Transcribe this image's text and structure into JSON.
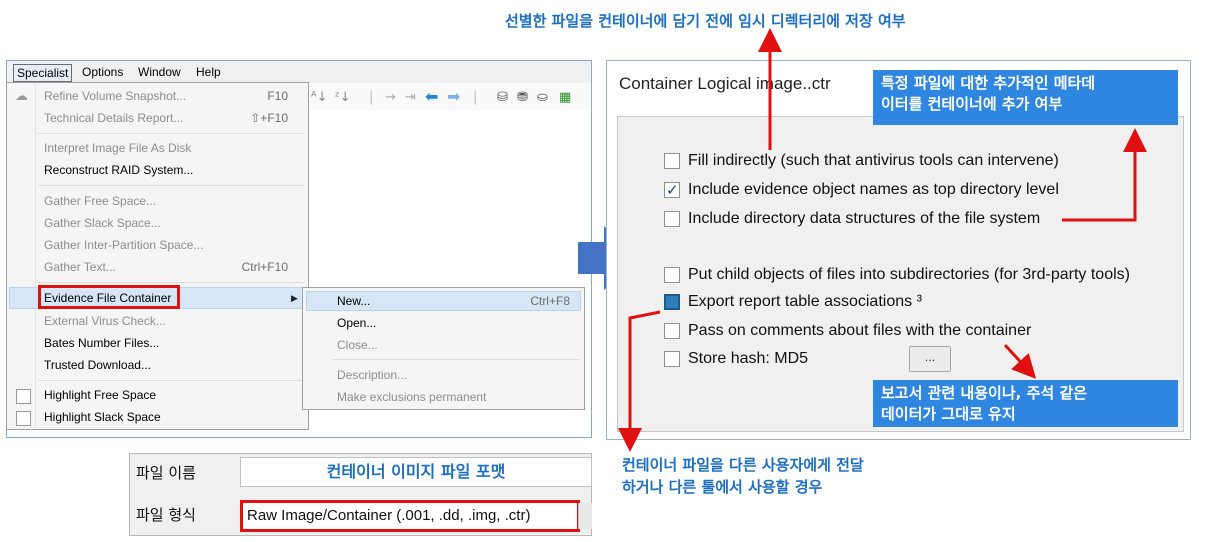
{
  "menubar": {
    "items": [
      "Specialist",
      "Options",
      "Window",
      "Help"
    ]
  },
  "menu": {
    "items": [
      {
        "label": "Refine Volume Snapshot...",
        "shortcut": "F10",
        "disabled": true
      },
      {
        "label": "Technical Details Report...",
        "shortcut": "⇧+F10",
        "disabled": true
      },
      {
        "label": "Interpret Image File As Disk",
        "shortcut": "",
        "disabled": true
      },
      {
        "label": "Reconstruct RAID System...",
        "shortcut": "",
        "disabled": false
      },
      {
        "label": "Gather Free Space...",
        "shortcut": "",
        "disabled": true
      },
      {
        "label": "Gather Slack Space...",
        "shortcut": "",
        "disabled": true
      },
      {
        "label": "Gather Inter-Partition Space...",
        "shortcut": "",
        "disabled": true
      },
      {
        "label": "Gather Text...",
        "shortcut": "Ctrl+F10",
        "disabled": true
      },
      {
        "label": "Evidence File Container",
        "shortcut": "",
        "disabled": false
      },
      {
        "label": "External Virus Check...",
        "shortcut": "",
        "disabled": true
      },
      {
        "label": "Bates Number Files...",
        "shortcut": "",
        "disabled": false
      },
      {
        "label": "Trusted Download...",
        "shortcut": "",
        "disabled": false
      },
      {
        "label": "Highlight Free Space",
        "shortcut": "",
        "disabled": false
      },
      {
        "label": "Highlight Slack Space",
        "shortcut": "",
        "disabled": false
      }
    ]
  },
  "submenu": {
    "items": [
      {
        "label": "New...",
        "shortcut": "Ctrl+F8",
        "disabled": false
      },
      {
        "label": "Open...",
        "shortcut": "",
        "disabled": false
      },
      {
        "label": "Close...",
        "shortcut": "",
        "disabled": true
      },
      {
        "label": "Description...",
        "shortcut": "",
        "disabled": true
      },
      {
        "label": "Make exclusions permanent",
        "shortcut": "",
        "disabled": true
      }
    ]
  },
  "dialog": {
    "title": "Container Logical image..ctr",
    "options": [
      {
        "label": "Fill indirectly (such that antivirus tools can intervene)",
        "checked": false
      },
      {
        "label": "Include evidence object names as top directory level",
        "checked": true
      },
      {
        "label": "Include directory data structures of the file system",
        "checked": false
      },
      {
        "label": "Put child objects of files into subdirectories (for 3rd-party tools)",
        "checked": false
      },
      {
        "label": "Export report table associations ³",
        "checked": "indeterminate"
      },
      {
        "label": "Pass on comments about files with the container",
        "checked": false
      },
      {
        "label": "Store hash: MD5",
        "checked": false
      }
    ],
    "hash_button": "..."
  },
  "annotations": {
    "top": "선별한 파일을 컨테이너에 담기 전에 임시 디렉터리에 저장 여부",
    "meta_line1": "특정 파일에 대한 추가적인 메타데",
    "meta_line2": "이터를 컨테이너에 추가 여부",
    "comments_line1": "보고서 관련 내용이나, 주석 같은",
    "comments_line2": "데이터가 그대로 유지",
    "share_line1": "컨테이너 파일을 다른 사용자에게 전달",
    "share_line2": "하거나 다른 툴에서 사용할 경우"
  },
  "file_dialog": {
    "name_label": "파일 이름",
    "name_value": "컨테이너 이미지 파일 포맷",
    "type_label": "파일 형식",
    "type_value": "Raw Image/Container (.001, .dd, .img, .ctr)"
  },
  "colors": {
    "annotation_red": "#e01010",
    "annotation_blue": "#2f86e0",
    "arrow_blue": "#4472c4"
  }
}
